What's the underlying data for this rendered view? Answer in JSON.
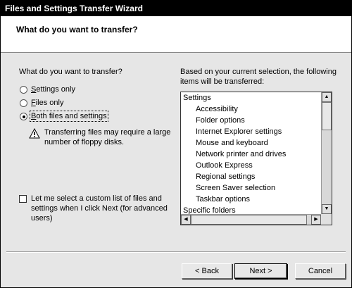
{
  "window": {
    "title": "Files and Settings Transfer Wizard"
  },
  "header": {
    "heading": "What do you want to transfer?"
  },
  "left": {
    "question": "What do you want to transfer?",
    "options": [
      {
        "label": "Settings only",
        "checked": false
      },
      {
        "label": "Files only",
        "checked": false
      },
      {
        "label": "Both files and settings",
        "checked": true
      }
    ],
    "warning_line1": "Transferring files may require a large",
    "warning_line2": "number of floppy disks.",
    "custom_line1": "Let me select a custom list of files and",
    "custom_line2": "settings when I click Next (for advanced",
    "custom_line3": "users)",
    "custom_checked": false
  },
  "right": {
    "desc_line1": "Based on your current selection, the following",
    "desc_line2": "items will be transferred:",
    "items": [
      "Settings",
      "Accessibility",
      "Folder options",
      "Internet Explorer settings",
      "Mouse and keyboard",
      "Network printer and drives",
      "Outlook Express",
      "Regional settings",
      "Screen Saver selection",
      "Taskbar options",
      "Specific folders"
    ]
  },
  "footer": {
    "back": "< Back",
    "next": "Next >",
    "cancel": "Cancel"
  }
}
